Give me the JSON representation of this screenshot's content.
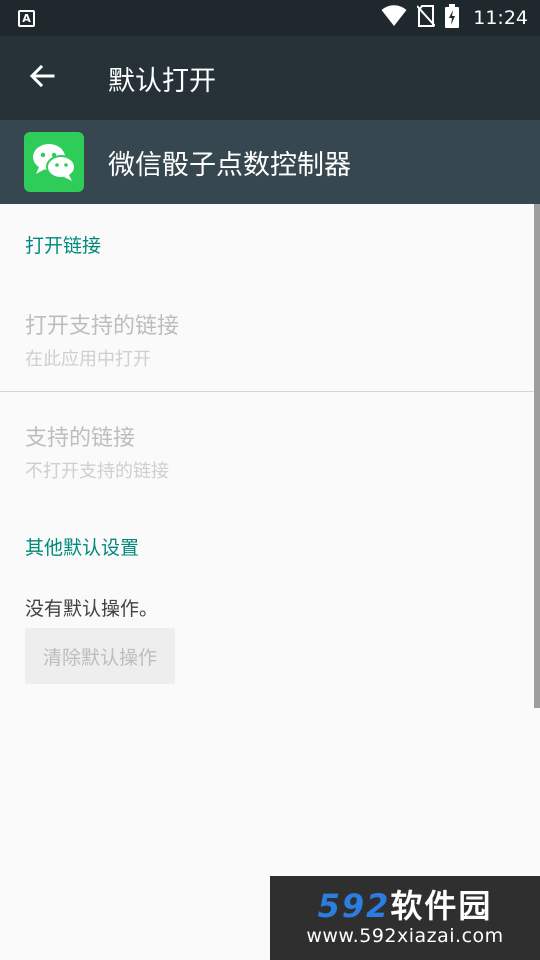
{
  "status_bar": {
    "notification_icon": "A",
    "time": "11:24",
    "icons": [
      "wifi-icon",
      "no-sim-icon",
      "battery-charging-icon"
    ]
  },
  "toolbar": {
    "back_icon": "arrow-back-icon",
    "title": "默认打开"
  },
  "app_header": {
    "app_icon": "wechat-icon",
    "app_name": "微信骰子点数控制器",
    "icon_color": "#2ecc59"
  },
  "sections": {
    "open_links": {
      "header": "打开链接",
      "open_supported": {
        "title": "打开支持的链接",
        "summary": "在此应用中打开"
      },
      "supported_links": {
        "title": "支持的链接",
        "summary": "不打开支持的链接"
      }
    },
    "other_defaults": {
      "header": "其他默认设置",
      "no_defaults_text": "没有默认操作。",
      "clear_button": "清除默认操作"
    }
  },
  "watermark": {
    "brand_number": "592",
    "brand_text": "软件园",
    "url": "www.592xiazai.com"
  },
  "colors": {
    "accent": "#00897b",
    "toolbar": "#263238",
    "app_header": "#37474f",
    "status_bar": "#1f282d"
  }
}
